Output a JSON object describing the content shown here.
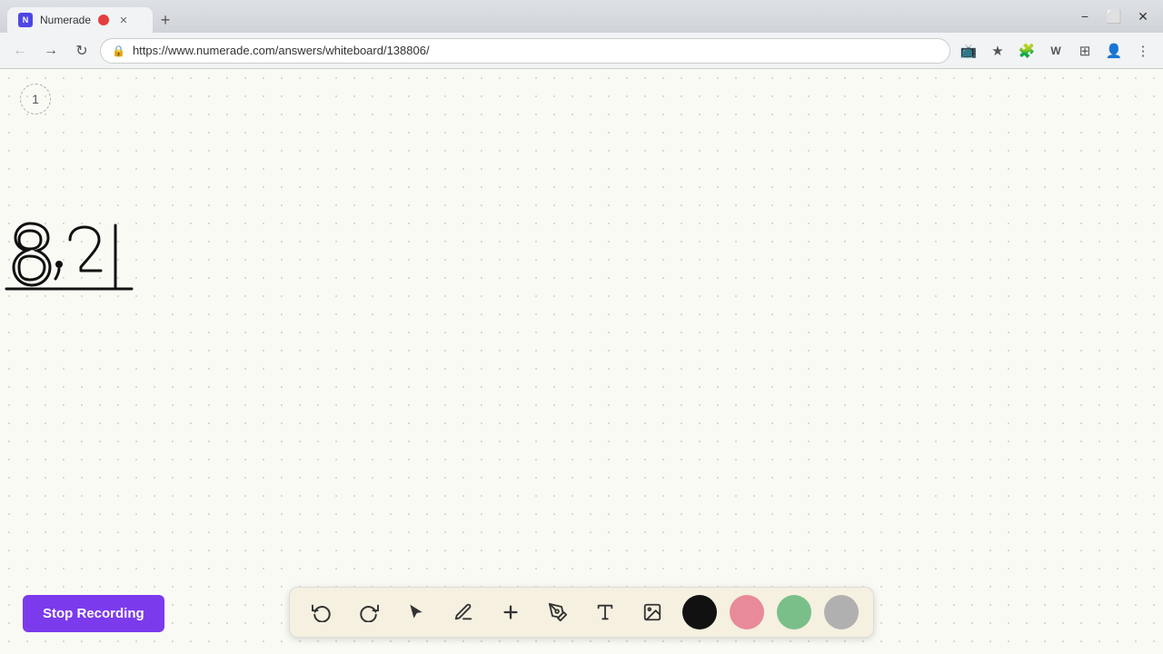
{
  "browser": {
    "tab_label": "Numerade",
    "tab_favicon": "N",
    "url": "https://www.numerade.com/answers/whiteboard/138806/",
    "new_tab_icon": "+",
    "window_controls": {
      "minimize": "−",
      "maximize": "⬜",
      "close": "✕"
    },
    "nav": {
      "back": "←",
      "forward": "→",
      "refresh": "↻",
      "lock_icon": "🔒"
    }
  },
  "page": {
    "page_number": "1",
    "background_color": "#fafaf5"
  },
  "toolbar": {
    "undo_label": "↩",
    "redo_label": "↪",
    "select_label": "▶",
    "pen_label": "✏",
    "add_label": "+",
    "highlight_label": "✏",
    "text_label": "A",
    "image_label": "🖼",
    "colors": [
      "#111111",
      "#e88a9a",
      "#7abf8a",
      "#b0b0b0"
    ]
  },
  "stop_recording": {
    "label": "Stop Recording",
    "bg_color": "#7c3aed"
  }
}
